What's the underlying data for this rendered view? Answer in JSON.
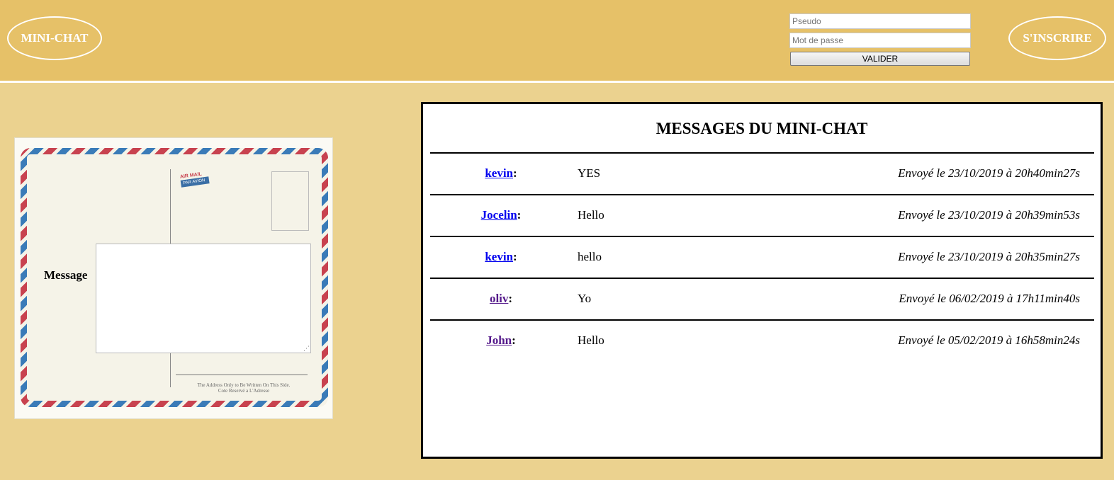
{
  "header": {
    "logo_label": "MINI-CHAT",
    "signup_label": "S'INSCRIRE",
    "login": {
      "pseudo_placeholder": "Pseudo",
      "password_placeholder": "Mot de passe",
      "submit_label": "VALIDER"
    }
  },
  "compose": {
    "message_label": "Message",
    "message_value": "",
    "postcard": {
      "airmail_text": "AIR MAIL",
      "par_avion_text": "PAR AVION",
      "footnote_line1": "The Address Only to Be Written On This Side.",
      "footnote_line2": "Cote Reservé a L'Adresse"
    }
  },
  "messages": {
    "title": "MESSAGES DU MINI-CHAT",
    "items": [
      {
        "author": "kevin",
        "text": "YES",
        "date": "Envoyé le 23/10/2019 à 20h40min27s",
        "link_color": "#0000ee"
      },
      {
        "author": "Jocelin",
        "text": "Hello",
        "date": "Envoyé le 23/10/2019 à 20h39min53s",
        "link_color": "#0000ee"
      },
      {
        "author": "kevin",
        "text": "hello",
        "date": "Envoyé le 23/10/2019 à 20h35min27s",
        "link_color": "#0000ee"
      },
      {
        "author": "oliv",
        "text": "Yo",
        "date": "Envoyé le 06/02/2019 à 17h11min40s",
        "link_color": "#551a8b"
      },
      {
        "author": "John",
        "text": "Hello",
        "date": "Envoyé le 05/02/2019 à 16h58min24s",
        "link_color": "#551a8b"
      }
    ]
  },
  "colors": {
    "header_bg": "#e6c168",
    "page_bg": "#ebd28f",
    "link_unvisited": "#0000ee",
    "link_visited": "#551a8b"
  }
}
